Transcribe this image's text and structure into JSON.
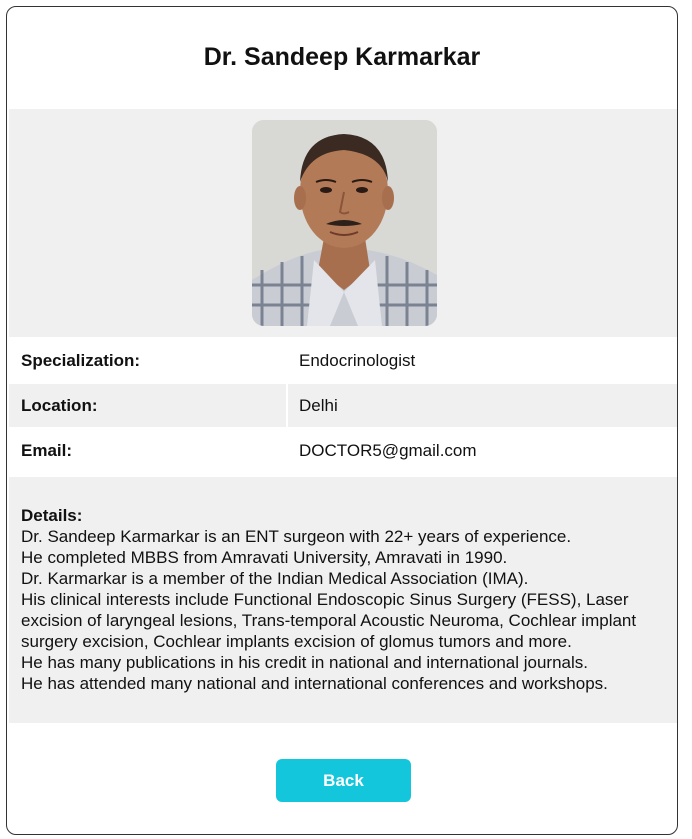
{
  "profile": {
    "name": "Dr. Sandeep Karmarkar",
    "photo_icon": "doctor-portrait-photo"
  },
  "fields": {
    "specialization": {
      "label": "Specialization:",
      "value": "Endocrinologist"
    },
    "location": {
      "label": "Location:",
      "value": "Delhi"
    },
    "email": {
      "label": "Email:",
      "value": "DOCTOR5@gmail.com"
    }
  },
  "details": {
    "label": "Details:",
    "lines": [
      "Dr. Sandeep Karmarkar is an ENT surgeon with 22+ years of experience.",
      "He completed MBBS from Amravati University, Amravati in 1990.",
      "Dr. Karmarkar is a member of the Indian Medical Association (IMA).",
      "His clinical interests include Functional Endoscopic Sinus Surgery (FESS), Laser excision of laryngeal lesions, Trans-temporal Acoustic Neuroma, Cochlear implant surgery excision, Cochlear implants excision of glomus tumors and more.",
      "He has many publications in his credit in national and international journals.",
      "He has attended many national and international conferences and workshops."
    ]
  },
  "actions": {
    "back_label": "Back"
  },
  "colors": {
    "accent": "#13c6dc",
    "band": "#f0f0f0"
  }
}
